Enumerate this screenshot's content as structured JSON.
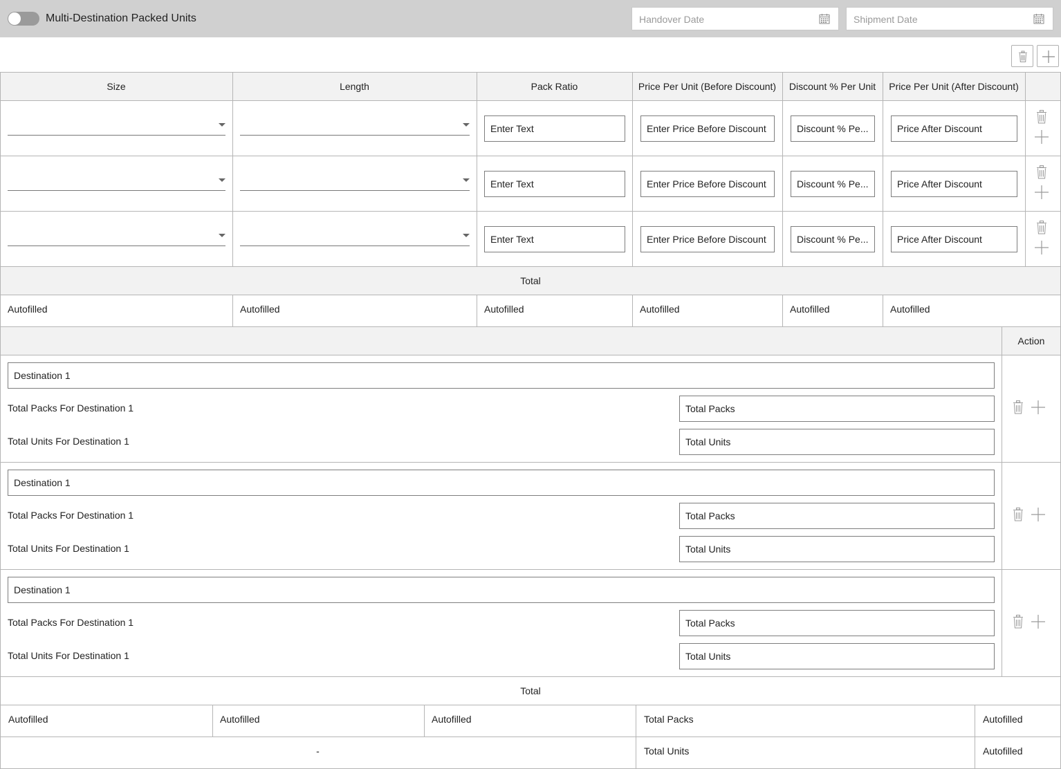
{
  "header": {
    "toggle_label": "Multi-Destination Packed Units",
    "toggle_on": false,
    "handover_placeholder": "Handover Date",
    "shipment_placeholder": "Shipment Date"
  },
  "size_table": {
    "columns": [
      "Size",
      "Length",
      "Pack Ratio",
      "Price Per Unit (Before Discount)",
      "Discount % Per Unit",
      "Price Per Unit (After Discount)"
    ],
    "rows": [
      {
        "size": "",
        "length": "",
        "pack_ratio_placeholder": "Enter Text",
        "price_before_placeholder": "Enter Price Before Discount",
        "discount_placeholder": "Discount % Pe...",
        "price_after_placeholder": "Price After Discount"
      },
      {
        "size": "",
        "length": "",
        "pack_ratio_placeholder": "Enter Text",
        "price_before_placeholder": "Enter Price Before Discount",
        "discount_placeholder": "Discount % Pe...",
        "price_after_placeholder": "Price After Discount"
      },
      {
        "size": "",
        "length": "",
        "pack_ratio_placeholder": "Enter Text",
        "price_before_placeholder": "Enter Price Before Discount",
        "discount_placeholder": "Discount % Pe...",
        "price_after_placeholder": "Price After Discount"
      }
    ],
    "total_label": "Total",
    "totals": [
      "Autofilled",
      "Autofilled",
      "Autofilled",
      "Autofilled",
      "Autofilled",
      "Autofilled"
    ]
  },
  "destinations": {
    "action_header": "Action",
    "items": [
      {
        "name": "Destination 1",
        "packs_label": "Total Packs For Destination 1",
        "packs_placeholder": "Total Packs",
        "units_label": "Total Units For Destination 1",
        "units_placeholder": "Total Units"
      },
      {
        "name": "Destination 1",
        "packs_label": "Total Packs For Destination 1",
        "packs_placeholder": "Total Packs",
        "units_label": "Total Units For Destination 1",
        "units_placeholder": "Total Units"
      },
      {
        "name": "Destination 1",
        "packs_label": "Total Packs For Destination 1",
        "packs_placeholder": "Total Packs",
        "units_label": "Total Units For Destination 1",
        "units_placeholder": "Total Units"
      }
    ]
  },
  "grand_total": {
    "label": "Total",
    "row1": [
      "Autofilled",
      "Autofilled",
      "Autofilled"
    ],
    "packs_label": "Total Packs",
    "packs_value": "Autofilled",
    "dash": "-",
    "units_label": "Total Units",
    "units_value": "Autofilled"
  },
  "icons": {
    "delete": "trash-icon",
    "add": "plus-icon",
    "calendar": "calendar-icon"
  }
}
